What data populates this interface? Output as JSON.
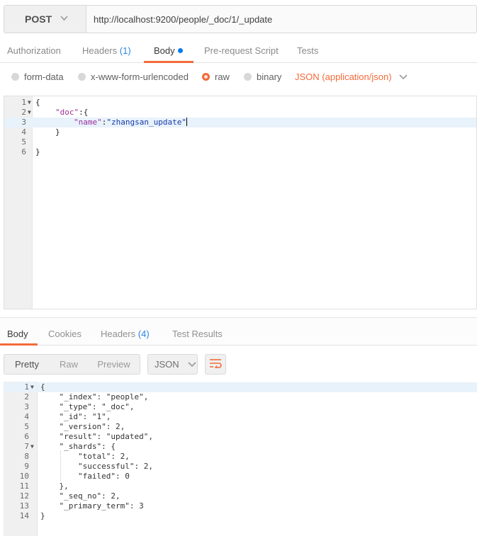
{
  "request": {
    "method": "POST",
    "url": "http://localhost:9200/people/_doc/1/_update"
  },
  "request_tabs": [
    {
      "label": "Authorization"
    },
    {
      "label": "Headers",
      "count": "(1)"
    },
    {
      "label": "Body"
    },
    {
      "label": "Pre-request Script"
    },
    {
      "label": "Tests"
    }
  ],
  "body_types": [
    "form-data",
    "x-www-form-urlencoded",
    "raw",
    "binary"
  ],
  "body_type_selected": "raw",
  "content_type": "JSON (application/json)",
  "request_body": {
    "line_numbers": [
      "1",
      "2",
      "3",
      "4",
      "5",
      "6"
    ],
    "lines": [
      {
        "open": "{"
      },
      {
        "key": "\"doc\"",
        "rest": ":{"
      },
      {
        "key": "\"name\"",
        "colon": ":",
        "value": "\"zhangsan_update\""
      },
      {
        "close": "}"
      },
      {},
      {
        "close": "}"
      }
    ]
  },
  "response_tabs": [
    {
      "label": "Body"
    },
    {
      "label": "Cookies"
    },
    {
      "label": "Headers",
      "count": "(4)"
    },
    {
      "label": "Test Results"
    }
  ],
  "view_modes": [
    "Pretty",
    "Raw",
    "Preview"
  ],
  "format": "JSON",
  "response_body": {
    "line_numbers": [
      "1",
      "2",
      "3",
      "4",
      "5",
      "6",
      "7",
      "8",
      "9",
      "10",
      "11",
      "12",
      "13",
      "14"
    ],
    "lines": [
      "{",
      "    \"_index\": \"people\",",
      "    \"_type\": \"_doc\",",
      "    \"_id\": \"1\",",
      "    \"_version\": 2,",
      "    \"result\": \"updated\",",
      "    \"_shards\": {",
      "        \"total\": 2,",
      "        \"successful\": 2,",
      "        \"failed\": 0",
      "    },",
      "    \"_seq_no\": 2,",
      "    \"_primary_term\": 3",
      "}"
    ]
  },
  "colors": {
    "accent": "#f26b3a",
    "count_blue": "#2b85e4",
    "unsaved_dot": "#097bed"
  }
}
